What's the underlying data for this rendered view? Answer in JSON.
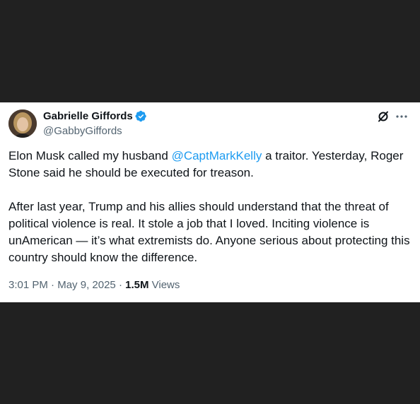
{
  "author": {
    "name": "Gabrielle Giffords",
    "handle": "@GabbyGiffords",
    "verified": true
  },
  "icons": {
    "avatar": "profile-photo",
    "verified": "verified-badge-icon",
    "grok": "grok-icon",
    "more": "more-options-icon"
  },
  "colors": {
    "background_dark": "#212121",
    "card_background": "#ffffff",
    "text_primary": "#0f1419",
    "text_secondary": "#536471",
    "accent": "#1d9bf0"
  },
  "tweet": {
    "paragraph1": {
      "before_mention": "Elon Musk called my husband ",
      "mention": "@CaptMarkKelly",
      "after_mention": " a traitor. Yesterday, Roger Stone said he should be executed for treason."
    },
    "paragraph2": "After last year, Trump and his allies should understand that the threat of political violence is real. It stole a job that I loved. Inciting violence is unAmerican — it’s what extremists do. Anyone serious about protecting this country should know the difference."
  },
  "meta": {
    "time": "3:01 PM",
    "separator1": " · ",
    "date": "May 9, 2025",
    "separator2": " · ",
    "views_count": "1.5M",
    "views_label": " Views"
  }
}
